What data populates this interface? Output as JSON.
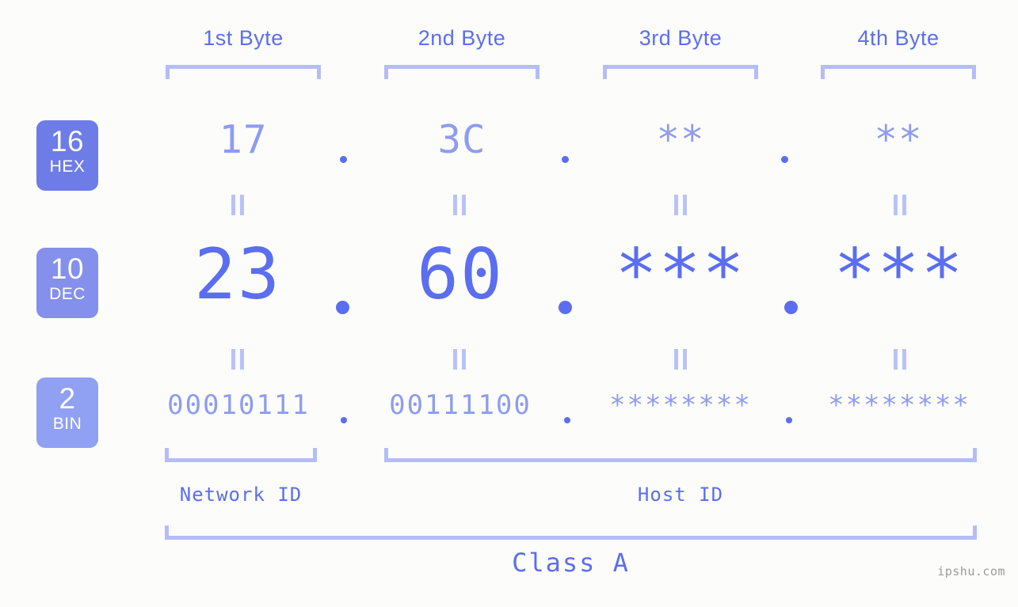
{
  "watermark": "ipshu.com",
  "columns": [
    {
      "header": "1st Byte"
    },
    {
      "header": "2nd Byte"
    },
    {
      "header": "3rd Byte"
    },
    {
      "header": "4th Byte"
    }
  ],
  "rows": {
    "hex": {
      "badge_num": "16",
      "badge_abbr": "HEX",
      "values": [
        "17",
        "3C",
        "**",
        "**"
      ],
      "separator": "."
    },
    "dec": {
      "badge_num": "10",
      "badge_abbr": "DEC",
      "values": [
        "23",
        "60",
        "***",
        "***"
      ],
      "separator": "."
    },
    "bin": {
      "badge_num": "2",
      "badge_abbr": "BIN",
      "values": [
        "00010111",
        "00111100",
        "********",
        "********"
      ],
      "separator": "."
    }
  },
  "sections": {
    "network_id": "Network ID",
    "host_id": "Host ID",
    "class": "Class A"
  },
  "colors": {
    "background": "#fcfdfa",
    "accent_strong": "#5b6ef0",
    "accent_mid": "#8e9cf0",
    "accent_light": "#b4bdf7",
    "badge_hex": "#6d7ce6",
    "badge_dec": "#8490ec",
    "badge_bin": "#90a0f2",
    "watermark": "#9a9a9a"
  }
}
